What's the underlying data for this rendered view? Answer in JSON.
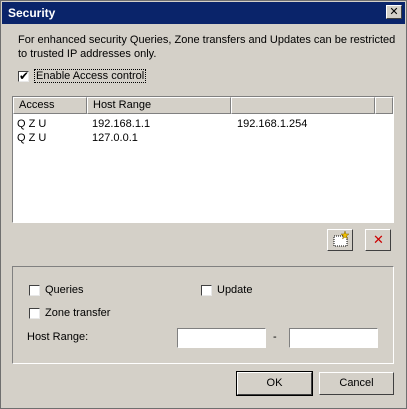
{
  "window": {
    "title": "Security",
    "close_symbol": "✕"
  },
  "description": "For enhanced security Queries, Zone transfers and Updates can be restricted to trusted IP addresses only.",
  "enable_access_control": {
    "label": "Enable  Access control",
    "checked": true,
    "check_glyph": "✔"
  },
  "list": {
    "columns": [
      "Access",
      "Host Range",
      ""
    ],
    "rows": [
      {
        "access": "Q Z U",
        "from": "192.168.1.1",
        "to": "192.168.1.254"
      },
      {
        "access": "Q Z U",
        "from": "127.0.0.1",
        "to": ""
      }
    ]
  },
  "toolbar": {
    "add_icon": "new-entry-icon",
    "delete_icon": "delete-icon",
    "delete_glyph": "✕"
  },
  "options": {
    "queries_label": "Queries",
    "update_label": "Update",
    "zone_transfer_label": "Zone transfer",
    "host_range_label": "Host Range:",
    "range_separator": "-",
    "host_from_value": "",
    "host_to_value": ""
  },
  "buttons": {
    "ok": "OK",
    "cancel": "Cancel"
  },
  "colors": {
    "title_bar": "#0a246a",
    "dialog_bg": "#d4d0c8",
    "delete_red": "#cc0000"
  }
}
